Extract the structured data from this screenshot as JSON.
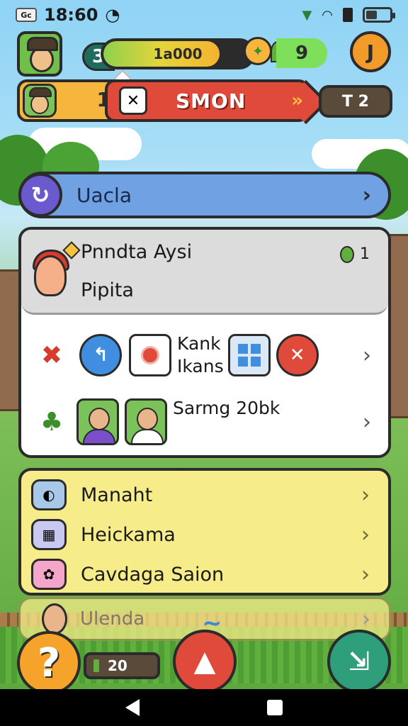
{
  "status": {
    "time": "18:60",
    "badge": "Gc",
    "battery_level": 0.45
  },
  "hud": {
    "level": "3",
    "xp_text": "1a000",
    "xp_fill": 0.78,
    "gems": "9",
    "profile_letter": "J",
    "friends": "1",
    "season_label": "SMON",
    "timer": "T 2"
  },
  "update": {
    "label": "Uacla"
  },
  "card": {
    "title": "Pnndta Aysi",
    "subtitle": "Pipita",
    "badge_count": "1",
    "row1_text_a": "Kank",
    "row1_text_b": "Ikans",
    "row2_text": "Sarmg 20bk"
  },
  "menu": {
    "items": [
      {
        "label": "Manaht",
        "icon": "disc-icon"
      },
      {
        "label": "Heickama",
        "icon": "calculator-icon"
      },
      {
        "label": "Cavdaga Saion",
        "icon": "flower-icon"
      }
    ],
    "faded_label": "Ulenda"
  },
  "bottom": {
    "help": "?",
    "energy": "20"
  },
  "colors": {
    "accent_red": "#e04a3a",
    "accent_blue": "#6fa1e3",
    "accent_yellow": "#f6ec8a",
    "accent_green": "#2f9e7a"
  }
}
